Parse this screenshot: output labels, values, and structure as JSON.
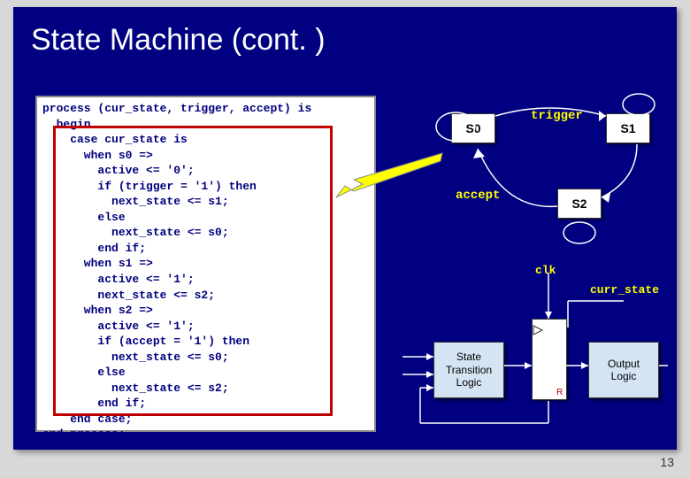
{
  "title": "State Machine (cont. )",
  "code": {
    "l1": "process (cur_state, trigger, accept) is",
    "l2": "  begin",
    "l3": "    case cur_state is",
    "l4": "      when s0 =>",
    "l5": "        active <= '0';",
    "l6": "        if (trigger = '1') then",
    "l7": "          next_state <= s1;",
    "l8": "        else",
    "l9": "          next_state <= s0;",
    "l10": "        end if;",
    "l11": "      when s1 =>",
    "l12": "        active <= '1';",
    "l13": "        next_state <= s2;",
    "l14": "      when s2 =>",
    "l15": "        active <= '1';",
    "l16": "        if (accept = '1') then",
    "l17": "          next_state <= s0;",
    "l18": "        else",
    "l19": "          next_state <= s2;",
    "l20": "        end if;",
    "l21": "    end case;",
    "l22": "end process;"
  },
  "states": {
    "s0": {
      "label": "S0"
    },
    "s1": {
      "label": "S1"
    },
    "s2": {
      "label": "S2"
    }
  },
  "edges": {
    "trigger": "trigger",
    "accept": "accept"
  },
  "signals": {
    "clk": "clk",
    "curr_state": "curr_state"
  },
  "blocks": {
    "stl": "State\nTransition\nLogic",
    "ol": "Output\nLogic"
  },
  "reg_label": "R",
  "page_number": "13"
}
